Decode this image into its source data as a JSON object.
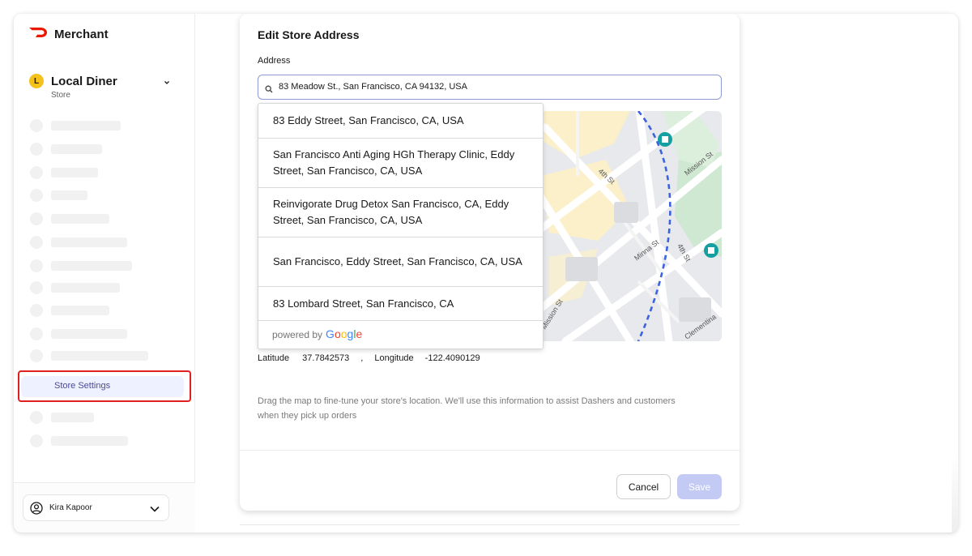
{
  "sidebar": {
    "brand": "Merchant",
    "store": {
      "initial": "L",
      "name": "Local Diner",
      "subtitle": "Store"
    },
    "active_item": "Store Settings",
    "user": {
      "name": "Kira Kapoor"
    }
  },
  "modal": {
    "title": "Edit Store Address",
    "address_label": "Address",
    "address_value": "83 Meadow St., San Francisco, CA 94132, USA",
    "suggestions": [
      "83 Eddy Street, San Francisco, CA, USA",
      "San Francisco Anti Aging HGh Therapy Clinic, Eddy Street, San Francisco, CA, USA",
      "Reinvigorate Drug Detox San Francisco, CA, Eddy Street, San Francisco, CA, USA",
      "San Francisco, Eddy Street, San Francisco, CA, USA",
      "83 Lombard Street, San Francisco, CA"
    ],
    "powered_by": "powered by",
    "google": [
      "G",
      "o",
      "o",
      "g",
      "l",
      "e"
    ],
    "map_labels": {
      "street_1": "4th St",
      "street_2": "Mission St",
      "street_3": "Minna St",
      "street_4": "4th St",
      "street_5": "Mission St",
      "street_6": "Clementina"
    },
    "latitude_label": "Latitude",
    "latitude_value": "37.7842573",
    "separator": ",",
    "longitude_label": "Longitude",
    "longitude_value": "-122.4090129",
    "help_text": "Drag the map to fine-tune your store's location. We'll use this information to assist Dashers and customers when they pick up orders",
    "cancel_label": "Cancel",
    "save_label": "Save"
  },
  "colors": {
    "accent": "#eb1700",
    "highlight": "#e02020",
    "save_disabled": "#c3cbf5",
    "active_nav_bg": "#eef1ff",
    "input_border": "#8f9bd6"
  }
}
